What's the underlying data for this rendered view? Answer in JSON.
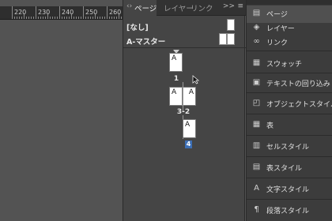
{
  "ruler": {
    "labels": [
      "220",
      "230",
      "240",
      "250",
      "260"
    ]
  },
  "pages_panel": {
    "tabs": [
      {
        "label": "ページ",
        "active": true
      },
      {
        "label": "レイヤー",
        "active": false
      },
      {
        "label": "リンク",
        "active": false
      }
    ],
    "more_label": ">>",
    "menu_label": "≡",
    "masters": [
      {
        "label": "[なし]"
      },
      {
        "label": "A-マスター"
      }
    ],
    "pages": [
      {
        "spread_label": "1",
        "letters": [
          "A"
        ]
      },
      {
        "spread_label": "3-2",
        "letters": [
          "A",
          "A"
        ]
      },
      {
        "spread_label": "4",
        "letters": [
          "A"
        ],
        "selected": true
      }
    ]
  },
  "dock": {
    "items": [
      {
        "label": "ページ",
        "icon": "pages-icon",
        "active": true
      },
      {
        "label": "レイヤー",
        "icon": "layers-icon"
      },
      {
        "label": "リンク",
        "icon": "links-icon"
      },
      {
        "label": "スウォッチ",
        "icon": "swatches-icon"
      },
      {
        "label": "テキストの回り込み",
        "icon": "text-wrap-icon"
      },
      {
        "label": "オブジェクトスタイル",
        "icon": "object-styles-icon"
      },
      {
        "label": "表",
        "icon": "table-icon"
      },
      {
        "label": "セルスタイル",
        "icon": "cell-styles-icon"
      },
      {
        "label": "表スタイル",
        "icon": "table-styles-icon"
      },
      {
        "label": "文字スタイル",
        "icon": "character-styles-icon"
      },
      {
        "label": "段落スタイル",
        "icon": "paragraph-styles-icon"
      }
    ]
  }
}
